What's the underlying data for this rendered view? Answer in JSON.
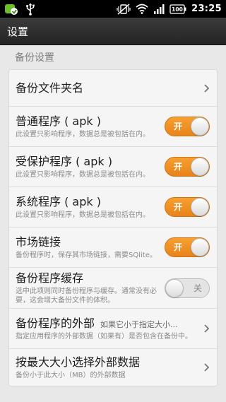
{
  "status_bar": {
    "time": "23:25",
    "battery": "100",
    "left_icons": [
      "app-notification-icon",
      "usb-icon"
    ],
    "right_icons": [
      "vibrate-mute-icon",
      "wifi-icon",
      "signal-icon",
      "battery-icon"
    ]
  },
  "title_bar": {
    "title": "设置"
  },
  "section": {
    "header": "备份设置"
  },
  "prefs": {
    "backup_folder": {
      "title": "备份文件夹名"
    },
    "normal_apps": {
      "title": "普通程序 ( apk )",
      "summary": "此设置只影响程序，数据总是被包括在内。",
      "toggle": "开"
    },
    "protected_apps": {
      "title": "受保护程序 ( apk )",
      "summary": "此设置只影响程序，数据总是被包括在内。",
      "toggle": "开"
    },
    "system_apps": {
      "title": "系统程序 ( apk )",
      "summary": "此设置只影响程序，数据总是被包括在内。",
      "toggle": "开"
    },
    "market_link": {
      "title": "市场链接",
      "summary": "备份程序时，保存其市场链接，需要SQlite。",
      "toggle": "开"
    },
    "backup_cache": {
      "title": "备份程序缓存",
      "summary": "选中此项则同时备份程序与缓存。通常没有必要，这会增大备份文件的体积。",
      "toggle": "关"
    },
    "external_data": {
      "title": "备份程序的外部",
      "value": "如果它小于指定大小...",
      "summary": "指定应用程序的外部数据（如果有）是否包含在备份中。"
    },
    "max_size": {
      "title": "按最大大小选择外部数据",
      "summary": "备份小于此大小（MB）的外部数据"
    }
  },
  "colors": {
    "toggle_on": "#f0901f",
    "toggle_off": "#e4e4e4",
    "title_bar": "#2f2f2f",
    "background": "#e8e8e8"
  }
}
